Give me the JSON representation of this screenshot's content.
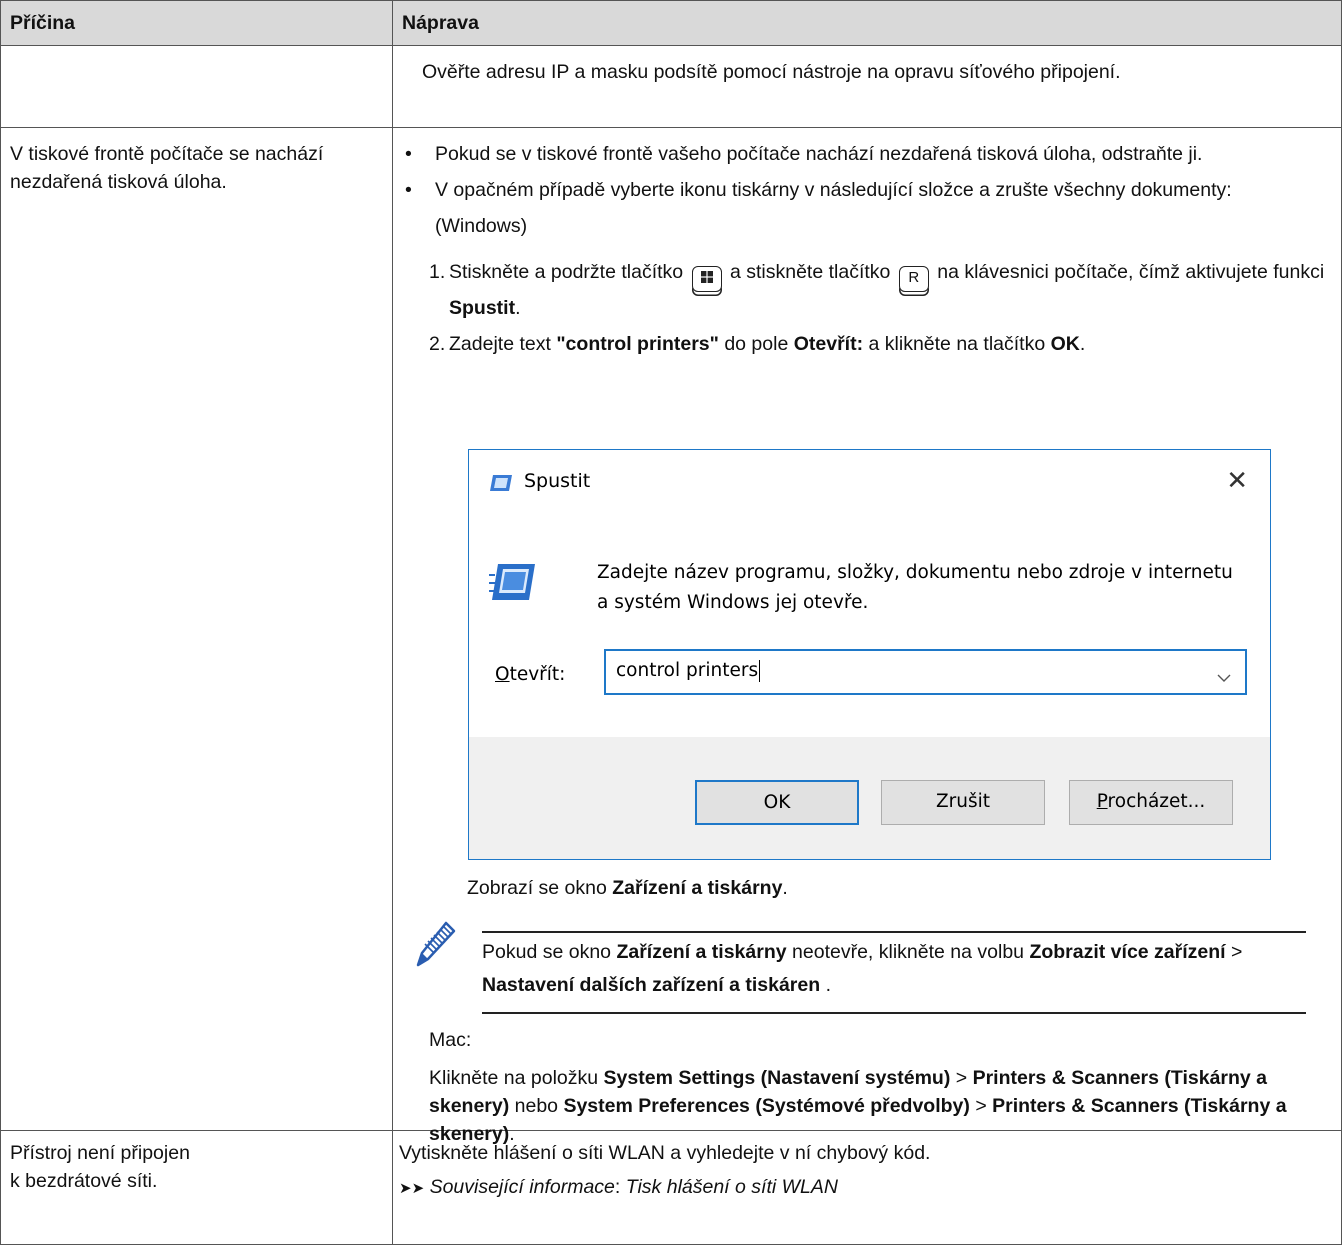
{
  "headers": {
    "cause": "Příčina",
    "remedy": "Náprava"
  },
  "row1": {
    "remedy": "Ověřte adresu IP a masku podsítě pomocí nástroje na opravu síťového připojení."
  },
  "row2": {
    "cause": "V tiskové frontě počítače se nachází nezdařená tisková úloha.",
    "bullet1": "Pokud se v tiskové frontě vašeho počítače nachází nezdařená tisková úloha, odstraňte ji.",
    "bullet2": "V opačném případě vyberte ikonu tiskárny v následující složce a zrušte všechny dokumenty:",
    "windows_label": "(Windows)",
    "step1": {
      "num": "1.",
      "a": "Stiskněte a podržte tlačítko",
      "b": "a stiskněte tlačítko",
      "key_r": "R",
      "c": "na klávesnici počítače, čímž aktivujete funkci",
      "bold": "Spustit",
      "end": "."
    },
    "step2": {
      "num": "2.",
      "a": "Zadejte text",
      "b1": "\"control printers\"",
      "c": "do pole",
      "b2": "Otevřít:",
      "d": "a klikněte na tlačítko",
      "b3": "OK",
      "end": "."
    },
    "dialog": {
      "title": "Spustit",
      "description": "Zadejte název programu, složky, dokumentu nebo zdroje v internetu a systém Windows jej otevře.",
      "open_label_u": "O",
      "open_label_rest": "tevřít:",
      "input_value": "control printers",
      "ok": "OK",
      "cancel": "Zrušit",
      "browse_u": "P",
      "browse_rest": "rocházet..."
    },
    "result": {
      "a": "Zobrazí se okno",
      "bold": "Zařízení a tiskárny",
      "end": "."
    },
    "note": {
      "a": "Pokud se okno",
      "b1": "Zařízení a tiskárny",
      "c": "neotevře, klikněte na volbu",
      "b2": "Zobrazit více zařízení",
      "sep": ">",
      "b3": "Nastavení dalších zařízení a tiskáren",
      "end": " ."
    },
    "mac_label": "Mac:",
    "mac": {
      "a": "Klikněte na položku",
      "b1": "System Settings (Nastavení systému)",
      "s1": ">",
      "b2": "Printers & Scanners (Tiskárny a skenery)",
      "c": "nebo",
      "b3": "System Preferences (Systémové předvolby)",
      "s2": ">",
      "b4": "Printers & Scanners (Tiskárny a skenery)",
      "end": "."
    }
  },
  "row3": {
    "cause_line1": "Přístroj není připojen",
    "cause_line2": "k bezdrátové síti.",
    "remedy": "Vytiskněte hlášení o síti WLAN a vyhledejte v ní chybový kód.",
    "link_prefix": "Související informace",
    "link_sep": ": ",
    "link_text": "Tisk hlášení o síti WLAN"
  }
}
